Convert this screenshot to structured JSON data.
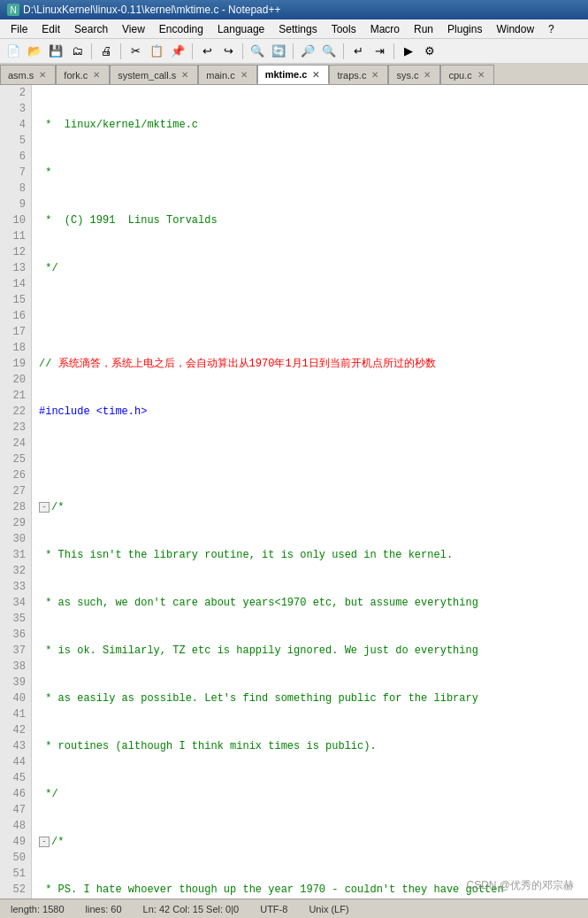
{
  "titleBar": {
    "title": "D:\\LinuxKernel\\linux-0.11\\kernel\\mktime.c - Notepad++",
    "icon": "N++"
  },
  "menuBar": {
    "items": [
      "File",
      "Edit",
      "Search",
      "View",
      "Encoding",
      "Language",
      "Settings",
      "Tools",
      "Macro",
      "Run",
      "Plugins",
      "Window",
      "?"
    ]
  },
  "tabs": [
    {
      "label": "asm.s",
      "modified": false,
      "active": false
    },
    {
      "label": "fork.c",
      "modified": false,
      "active": false
    },
    {
      "label": "system_call.s",
      "modified": false,
      "active": false
    },
    {
      "label": "main.c",
      "modified": false,
      "active": false
    },
    {
      "label": "mktime.c",
      "modified": false,
      "active": true
    },
    {
      "label": "traps.c",
      "modified": false,
      "active": false
    },
    {
      "label": "sys.c",
      "modified": false,
      "active": false
    },
    {
      "label": "cpu.c",
      "modified": false,
      "active": false
    }
  ],
  "statusBar": {
    "line": "length: 1580",
    "col": "lines: 60",
    "pos": "Ln: 42  Col: 15  Sel: 0|0",
    "encoding": "UTF-8",
    "lineEnding": "Unix (LF)"
  },
  "watermark": "CSDN @优秀的邓宗赫"
}
